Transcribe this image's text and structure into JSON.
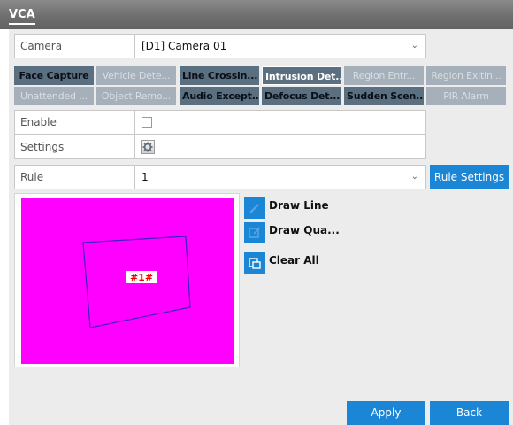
{
  "window": {
    "title": "VCA"
  },
  "camera": {
    "label": "Camera",
    "value": "[D1] Camera 01"
  },
  "tabs": [
    {
      "label": "Face Capture",
      "state": "enabled"
    },
    {
      "label": "Vehicle Dete...",
      "state": "disabled"
    },
    {
      "label": "Line Crossin...",
      "state": "enabled"
    },
    {
      "label": "Intrusion Det...",
      "state": "active"
    },
    {
      "label": "Region Entr...",
      "state": "disabled"
    },
    {
      "label": "Region Exitin...",
      "state": "disabled"
    },
    {
      "label": "Unattended ...",
      "state": "disabled"
    },
    {
      "label": "Object Remo...",
      "state": "disabled"
    },
    {
      "label": "Audio Except...",
      "state": "enabled"
    },
    {
      "label": "Defocus Det...",
      "state": "enabled"
    },
    {
      "label": "Sudden Scen...",
      "state": "enabled"
    },
    {
      "label": "PIR Alarm",
      "state": "disabled"
    }
  ],
  "enable": {
    "label": "Enable",
    "checked": false
  },
  "settings": {
    "label": "Settings",
    "icon": "gear-icon"
  },
  "rule": {
    "label": "Rule",
    "value": "1",
    "settings_button": "Rule Settings"
  },
  "preview": {
    "background_color": "#ff00ff",
    "region_color": "#4020c0",
    "region_label": "#1#"
  },
  "tools": [
    {
      "label": "Draw Line",
      "icon": "draw-line-icon"
    },
    {
      "label": "Draw Qua...",
      "icon": "draw-quadrilateral-icon"
    },
    {
      "label": "Clear All",
      "icon": "clear-all-icon"
    }
  ],
  "footer": {
    "apply": "Apply",
    "back": "Back"
  },
  "colors": {
    "accent": "#1b86d6",
    "titlebar": "#737373",
    "tab_enabled": "#5a6f80",
    "tab_disabled": "#a5b0ba"
  }
}
